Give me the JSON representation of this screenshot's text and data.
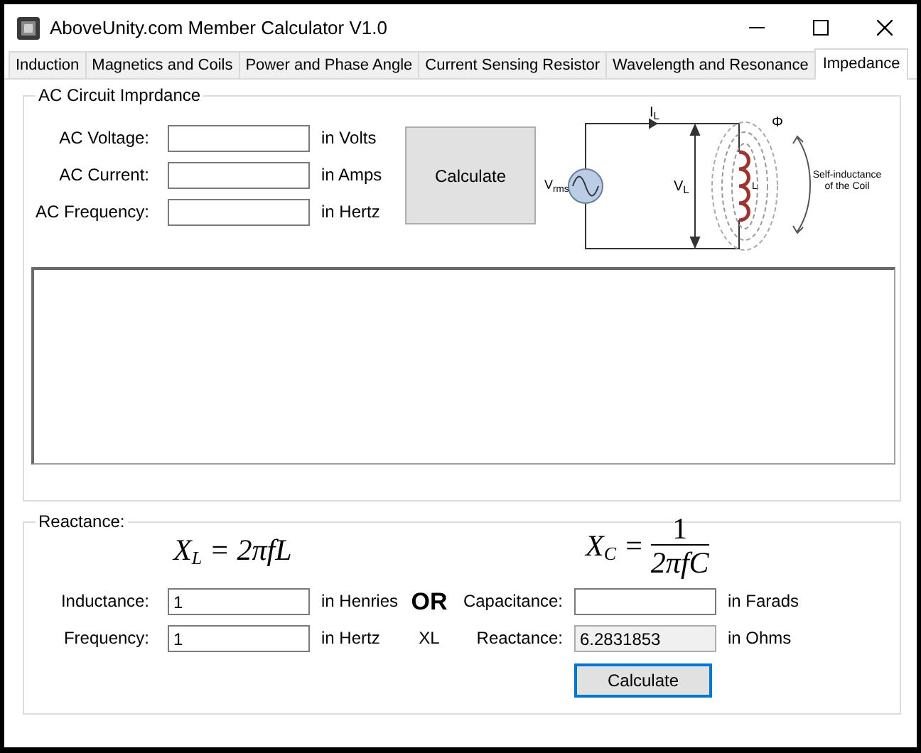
{
  "window": {
    "title": "AboveUnity.com Member Calculator V1.0"
  },
  "tabs": [
    {
      "label": "Induction",
      "selected": false
    },
    {
      "label": "Magnetics and Coils",
      "selected": false
    },
    {
      "label": "Power and Phase Angle",
      "selected": false
    },
    {
      "label": "Current Sensing Resistor",
      "selected": false
    },
    {
      "label": "Wavelength and Resonance",
      "selected": false
    },
    {
      "label": "Impedance",
      "selected": true
    }
  ],
  "impedance_group": {
    "title": "AC Circuit Imprdance",
    "fields": [
      {
        "label": "AC Voltage:",
        "unit": "in Volts"
      },
      {
        "label": "AC Current:",
        "unit": "in Amps"
      },
      {
        "label": "AC Frequency:",
        "unit": "in Hertz"
      }
    ],
    "button": {
      "label": "Calculate",
      "focused": false
    },
    "diagram": {
      "current_label": "I$_{L}$",
      "source_label": "V$_{rms}$",
      "voltage_label": "V$_{L}$",
      "inductor_label": "L",
      "flux_label": "Φ",
      "caption": "Self-inductance of the Coil"
    }
  },
  "reactance_group": {
    "title": "Reactance:",
    "formula_xl": "X$_{L}$ = 2πfL",
    "formula_xc": {
      "lhs": "X$_{C}$ =",
      "numerator": "1",
      "denominator": "2πfC"
    },
    "separator": "OR",
    "mode_label": "XL",
    "left_fields": [
      {
        "label": "Inductance:",
        "value": "1",
        "unit": "in Henries"
      },
      {
        "label": "Frequency:",
        "value": "1",
        "unit": "in Hertz"
      }
    ],
    "right_fields": [
      {
        "label": "Capacitance:",
        "unit": "in Farads",
        "readonly": false
      },
      {
        "label": "Reactance:",
        "value": "6.2831853",
        "unit": "in Ohms",
        "readonly": true
      }
    ],
    "button": {
      "label": "Calculate",
      "focused": true
    }
  }
}
